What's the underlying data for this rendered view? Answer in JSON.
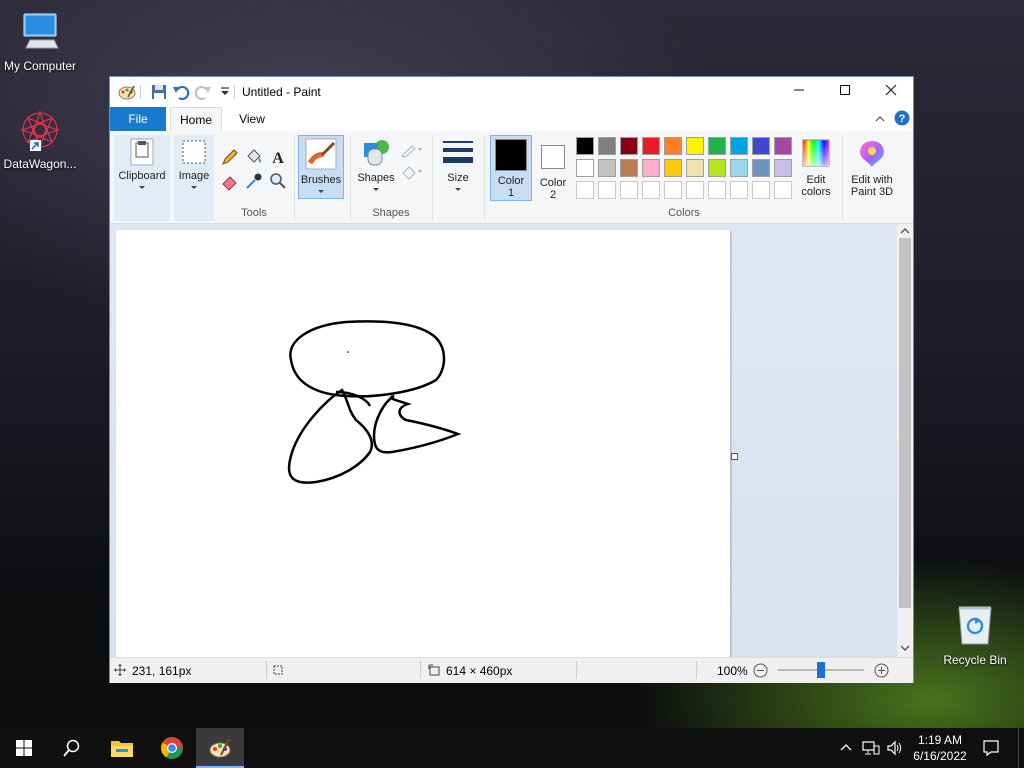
{
  "desktop": {
    "icons": [
      {
        "label": "My Computer"
      },
      {
        "label": "DataWagon..."
      },
      {
        "label": "Recycle Bin"
      }
    ]
  },
  "window": {
    "title": "Untitled - Paint",
    "tabs": {
      "file": "File",
      "home": "Home",
      "view": "View"
    },
    "ribbon": {
      "clipboard": "Clipboard",
      "image": "Image",
      "tools": "Tools",
      "brushes": "Brushes",
      "shapes_button": "Shapes",
      "shapes_group": "Shapes",
      "size": "Size",
      "color1_a": "Color",
      "color1_b": "1",
      "color2_a": "Color",
      "color2_b": "2",
      "colors_group": "Colors",
      "edit_colors_a": "Edit",
      "edit_colors_b": "colors",
      "edit_paint3d_a": "Edit with",
      "edit_paint3d_b": "Paint 3D"
    },
    "palette": {
      "row1": [
        "#000000",
        "#7f7f7f",
        "#880015",
        "#ed1c24",
        "#ff7f27",
        "#fff200",
        "#22b14c",
        "#00a2e8",
        "#3f48cc",
        "#a349a4"
      ],
      "row2": [
        "#ffffff",
        "#c3c3c3",
        "#b97a57",
        "#ffaec9",
        "#ffc90e",
        "#efe4b0",
        "#b5e61d",
        "#99d9ea",
        "#7092be",
        "#c8bfe7"
      ],
      "row3": [
        "#ffffff",
        "#ffffff",
        "#ffffff",
        "#ffffff",
        "#ffffff",
        "#ffffff",
        "#ffffff",
        "#ffffff",
        "#ffffff",
        "#ffffff"
      ]
    },
    "color1": "#000000",
    "color2": "#ffffff",
    "status": {
      "cursor_pos": "231, 161px",
      "image_size": "614 × 460px",
      "zoom": "100%"
    }
  },
  "taskbar": {
    "time": "1:19 AM",
    "date": "6/16/2022"
  }
}
